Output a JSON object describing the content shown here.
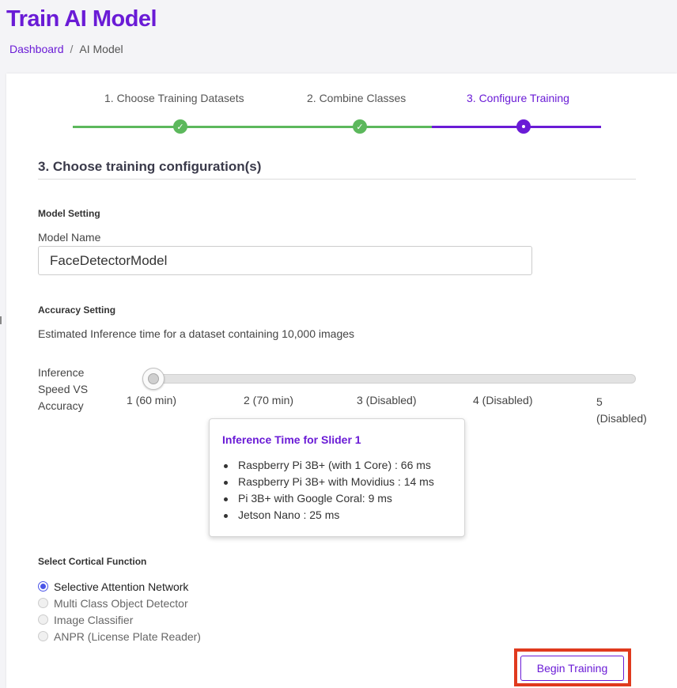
{
  "header": {
    "title": "Train AI Model"
  },
  "breadcrumb": {
    "root": "Dashboard",
    "separator": "/",
    "current": "AI Model"
  },
  "stepper": {
    "steps": [
      {
        "label": "1. Choose Training Datasets",
        "status": "done"
      },
      {
        "label": "2. Combine Classes",
        "status": "done"
      },
      {
        "label": "3. Configure Training",
        "status": "active"
      }
    ]
  },
  "section": {
    "title": "3. Choose training configuration(s)"
  },
  "model_setting": {
    "heading": "Model Setting",
    "name_label": "Model Name",
    "name_value": "FaceDetectorModel"
  },
  "accuracy_setting": {
    "heading": "Accuracy Setting",
    "estimate_text": "Estimated Inference time for a dataset containing 10,000 images",
    "slider_label": "Inference Speed VS Accuracy",
    "slider_value": 1,
    "ticks": [
      "1 (60 min)",
      "2 (70 min)",
      "3 (Disabled)",
      "4 (Disabled)",
      "5 (Disabled)"
    ]
  },
  "tooltip": {
    "title": "Inference Time for Slider 1",
    "items": [
      "Raspberry Pi 3B+ (with 1 Core) : 66 ms",
      "Raspberry Pi 3B+ with Movidius : 14 ms",
      "Pi 3B+ with Google Coral: 9 ms",
      "Jetson Nano : 25 ms"
    ]
  },
  "cortical": {
    "heading": "Select Cortical Function",
    "options": [
      {
        "label": "Selective Attention Network",
        "selected": true
      },
      {
        "label": "Multi Class Object Detector",
        "selected": false
      },
      {
        "label": "Image Classifier",
        "selected": false
      },
      {
        "label": "ANPR (License Plate Reader)",
        "selected": false
      }
    ]
  },
  "actions": {
    "begin_label": "Begin Training"
  },
  "colors": {
    "accent": "#6a1bd6",
    "success": "#5cb85c",
    "highlight": "#e03a1e",
    "radio": "#4a54e8"
  }
}
